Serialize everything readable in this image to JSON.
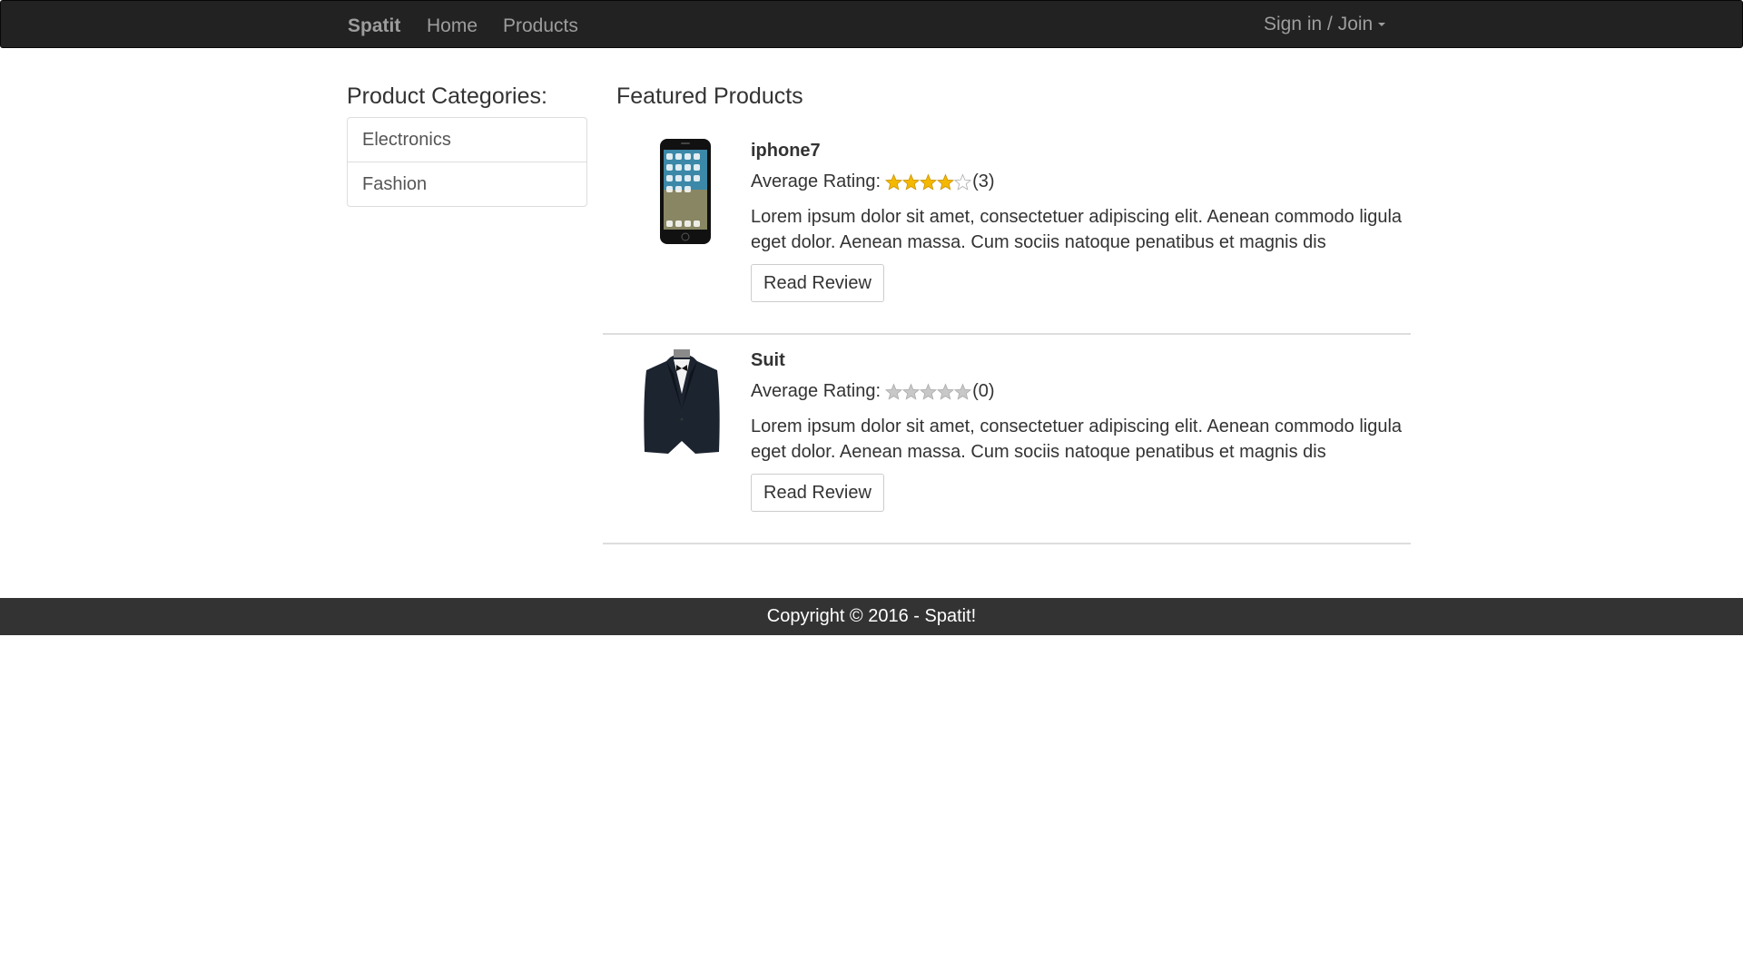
{
  "navbar": {
    "brand": "Spatit",
    "links": [
      "Home",
      "Products"
    ],
    "signin_label": "Sign in / Join"
  },
  "sidebar": {
    "heading": "Product Categories:",
    "categories": [
      "Electronics",
      "Fashion"
    ]
  },
  "main": {
    "heading": "Featured Products",
    "products": [
      {
        "name": "iphone7",
        "rating_label": "Average Rating:",
        "rating": 4,
        "rating_max": 5,
        "rating_count": "(3)",
        "description": "Lorem ipsum dolor sit amet, consectetuer adipiscing elit. Aenean commodo ligula eget dolor. Aenean massa. Cum sociis natoque penatibus et magnis dis",
        "button_label": "Read Review",
        "image": "phone-image"
      },
      {
        "name": "Suit",
        "rating_label": "Average Rating:",
        "rating": 0,
        "rating_max": 5,
        "rating_count": "(0)",
        "description": "Lorem ipsum dolor sit amet, consectetuer adipiscing elit. Aenean commodo ligula eget dolor. Aenean massa. Cum sociis natoque penatibus et magnis dis",
        "button_label": "Read Review",
        "image": "suit-image"
      }
    ]
  },
  "footer": {
    "copyright": "Copyright © 2016 - Spatit!"
  },
  "colors": {
    "navbar_bg": "#222222",
    "footer_bg": "#333333",
    "star_filled": "#f5b800",
    "star_empty": "#c8c8c8"
  }
}
